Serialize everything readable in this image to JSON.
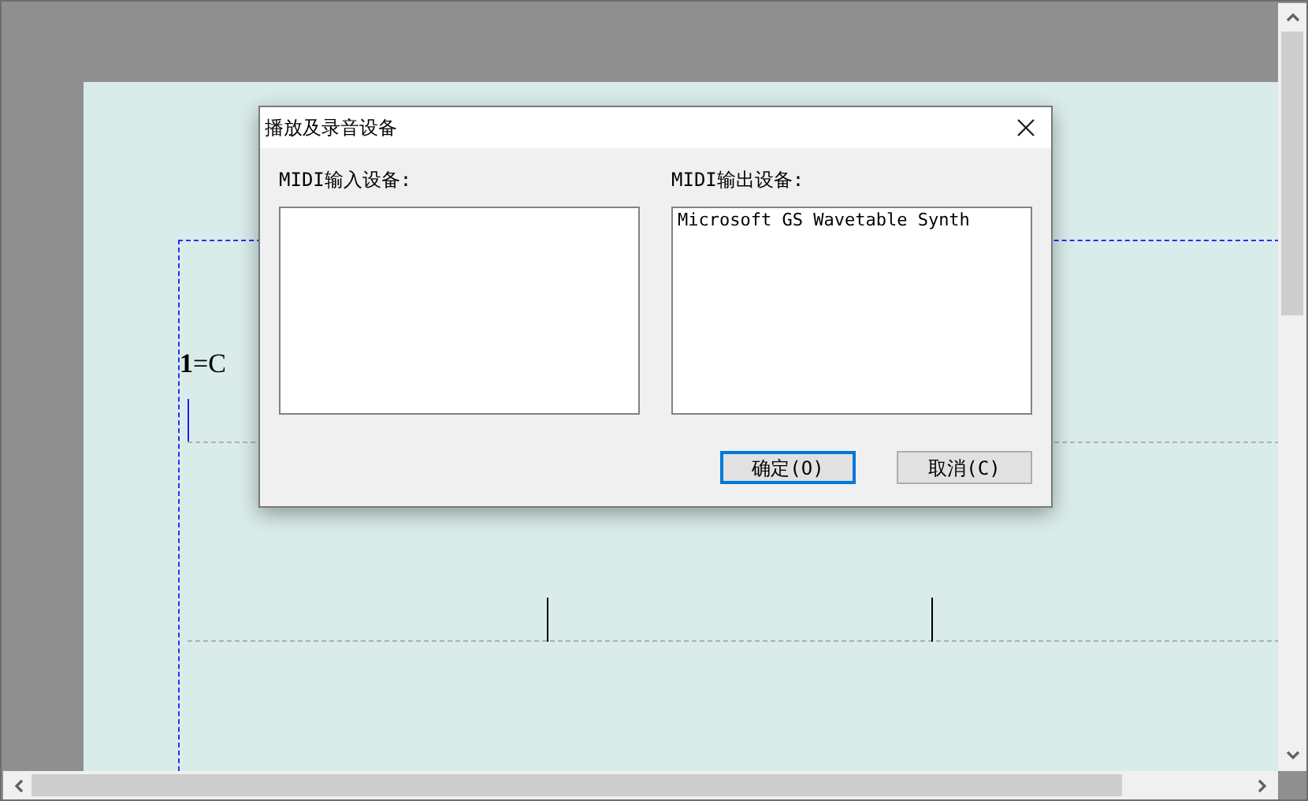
{
  "score": {
    "key_signature": "**1**=C"
  },
  "dialog": {
    "title": "播放及录音设备",
    "lists": [
      {
        "label": "MIDI输入设备:"
      },
      {
        "label": "MIDI输出设备:",
        "items": [
          "Microsoft GS Wavetable Synth"
        ]
      }
    ],
    "buttons": [
      {
        "label": "确定(O)",
        "focused": true
      },
      {
        "label": "取消(C)",
        "focused": false
      }
    ]
  }
}
